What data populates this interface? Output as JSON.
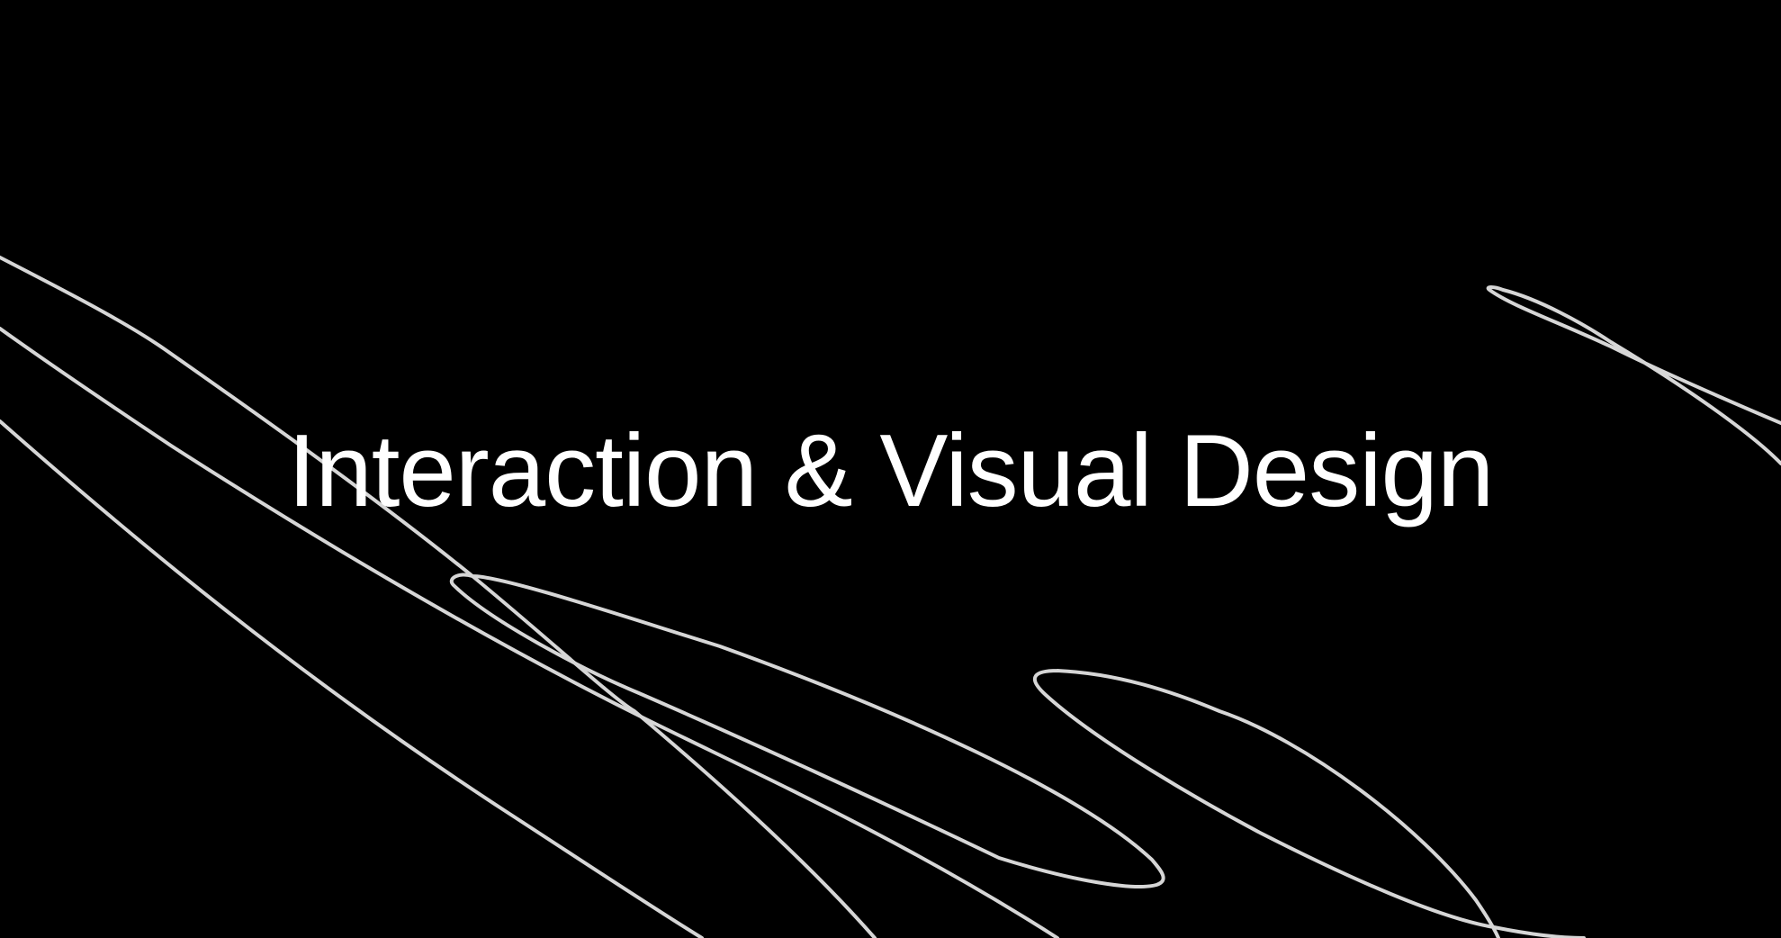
{
  "hero": {
    "title": "Interaction & Visual Design"
  },
  "colors": {
    "background": "#000000",
    "title": "#ffffff",
    "line": "#d6d6d6"
  }
}
